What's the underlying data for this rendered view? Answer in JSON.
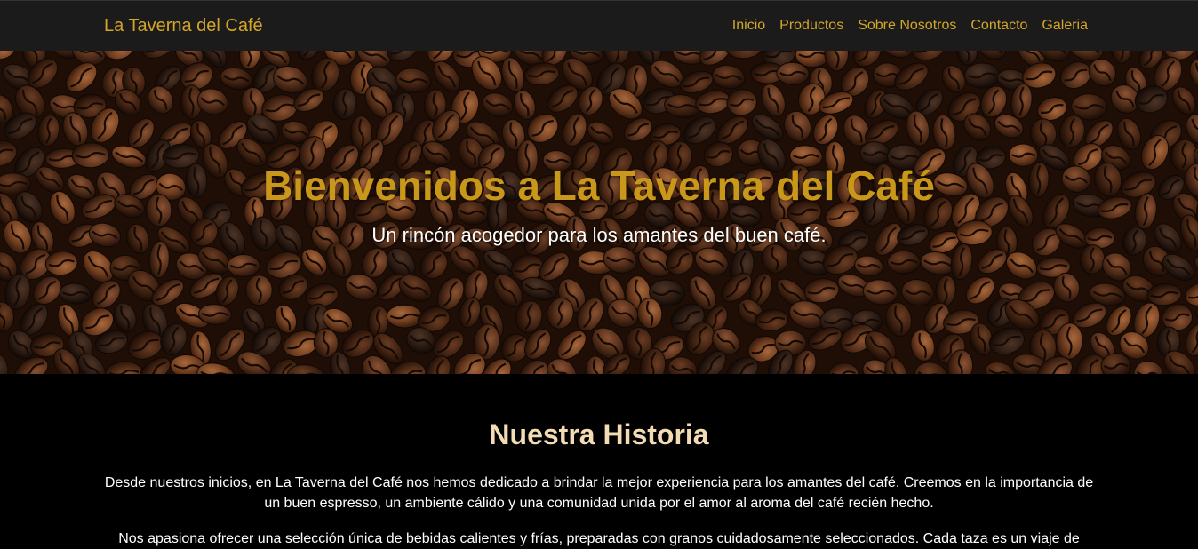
{
  "nav": {
    "brand": "La Taverna del Café",
    "links": [
      "Inicio",
      "Productos",
      "Sobre Nosotros",
      "Contacto",
      "Galeria"
    ]
  },
  "hero": {
    "title": "Bienvenidos a La Taverna del Café",
    "subtitle": "Un rincón acogedor para los amantes del buen café."
  },
  "story": {
    "title": "Nuestra Historia",
    "paragraphs": [
      "Desde nuestros inicios, en La Taverna del Café nos hemos dedicado a brindar la mejor experiencia para los amantes del café. Creemos en la importancia de un buen espresso, un ambiente cálido y una comunidad unida por el amor al aroma del café recién hecho.",
      "Nos apasiona ofrecer una selección única de bebidas calientes y frías, preparadas con granos cuidadosamente seleccionados. Cada taza es un viaje de"
    ]
  },
  "colors": {
    "accent": "#d4a628",
    "hero_title": "#c9971a",
    "navbar_bg": "#1b1b1b",
    "page_bg": "#000000",
    "heading": "#f3dcb4"
  },
  "hero_image": "coffee-beans-background"
}
